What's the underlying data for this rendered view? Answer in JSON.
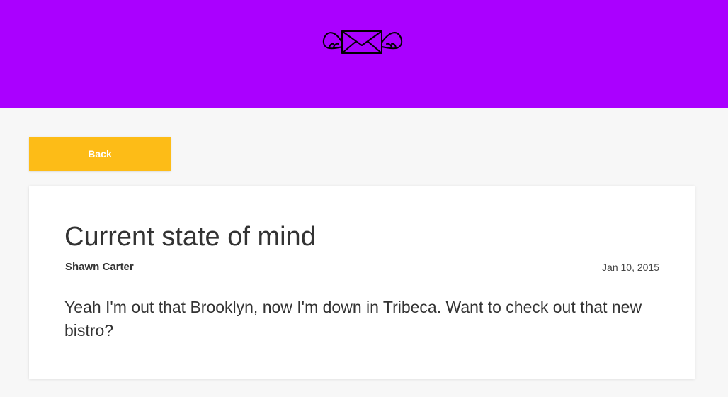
{
  "header": {
    "background_color": "#aa00ff",
    "logo_icon": "winged-envelope-icon"
  },
  "toolbar": {
    "back_label": "Back",
    "back_button_color": "#fdbc17"
  },
  "message": {
    "title": "Current state of mind",
    "author": "Shawn Carter",
    "date": "Jan 10, 2015",
    "body": "Yeah I'm out that Brooklyn, now I'm down in Tribeca. Want to check out that new bistro?"
  }
}
